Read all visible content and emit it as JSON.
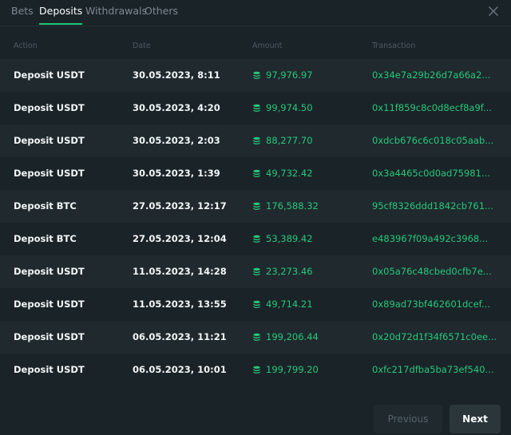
{
  "tabs": [
    {
      "label": "Bets"
    },
    {
      "label": "Deposits"
    },
    {
      "label": "Withdrawals"
    },
    {
      "label": "Others"
    }
  ],
  "active_tab": "Deposits",
  "columns": {
    "action": "Action",
    "date": "Date",
    "amount": "Amount",
    "transaction": "Transaction"
  },
  "rows": [
    {
      "action": "Deposit USDT",
      "date": "30.05.2023, 8:11",
      "amount": "97,976.97",
      "tx": "0x34e7a29b26d7a66a2..."
    },
    {
      "action": "Deposit USDT",
      "date": "30.05.2023, 4:20",
      "amount": "99,974.50",
      "tx": "0x11f859c8c0d8ecf8a9f..."
    },
    {
      "action": "Deposit USDT",
      "date": "30.05.2023, 2:03",
      "amount": "88,277.70",
      "tx": "0xdcb676c6c018c05aab..."
    },
    {
      "action": "Deposit USDT",
      "date": "30.05.2023, 1:39",
      "amount": "49,732.42",
      "tx": "0x3a4465c0d0ad75981..."
    },
    {
      "action": "Deposit BTC",
      "date": "27.05.2023, 12:17",
      "amount": "176,588.32",
      "tx": "95cf8326ddd1842cb761..."
    },
    {
      "action": "Deposit BTC",
      "date": "27.05.2023, 12:04",
      "amount": "53,389.42",
      "tx": "e483967f09a492c3968..."
    },
    {
      "action": "Deposit USDT",
      "date": "11.05.2023, 14:28",
      "amount": "23,273.46",
      "tx": "0x05a76c48cbed0cfb7e..."
    },
    {
      "action": "Deposit USDT",
      "date": "11.05.2023, 13:55",
      "amount": "49,714.21",
      "tx": "0x89ad73bf462601dcef..."
    },
    {
      "action": "Deposit USDT",
      "date": "06.05.2023, 11:21",
      "amount": "199,206.44",
      "tx": "0x20d72d1f34f6571c0ee..."
    },
    {
      "action": "Deposit USDT",
      "date": "06.05.2023, 10:01",
      "amount": "199,799.20",
      "tx": "0xfc217dfba5ba73ef540..."
    }
  ],
  "pagination": {
    "previous_label": "Previous",
    "next_label": "Next"
  },
  "colors": {
    "accent": "#1fc777",
    "background": "#1a2328"
  },
  "icons": {
    "close": "close-icon",
    "coin": "coin-stack-icon"
  }
}
